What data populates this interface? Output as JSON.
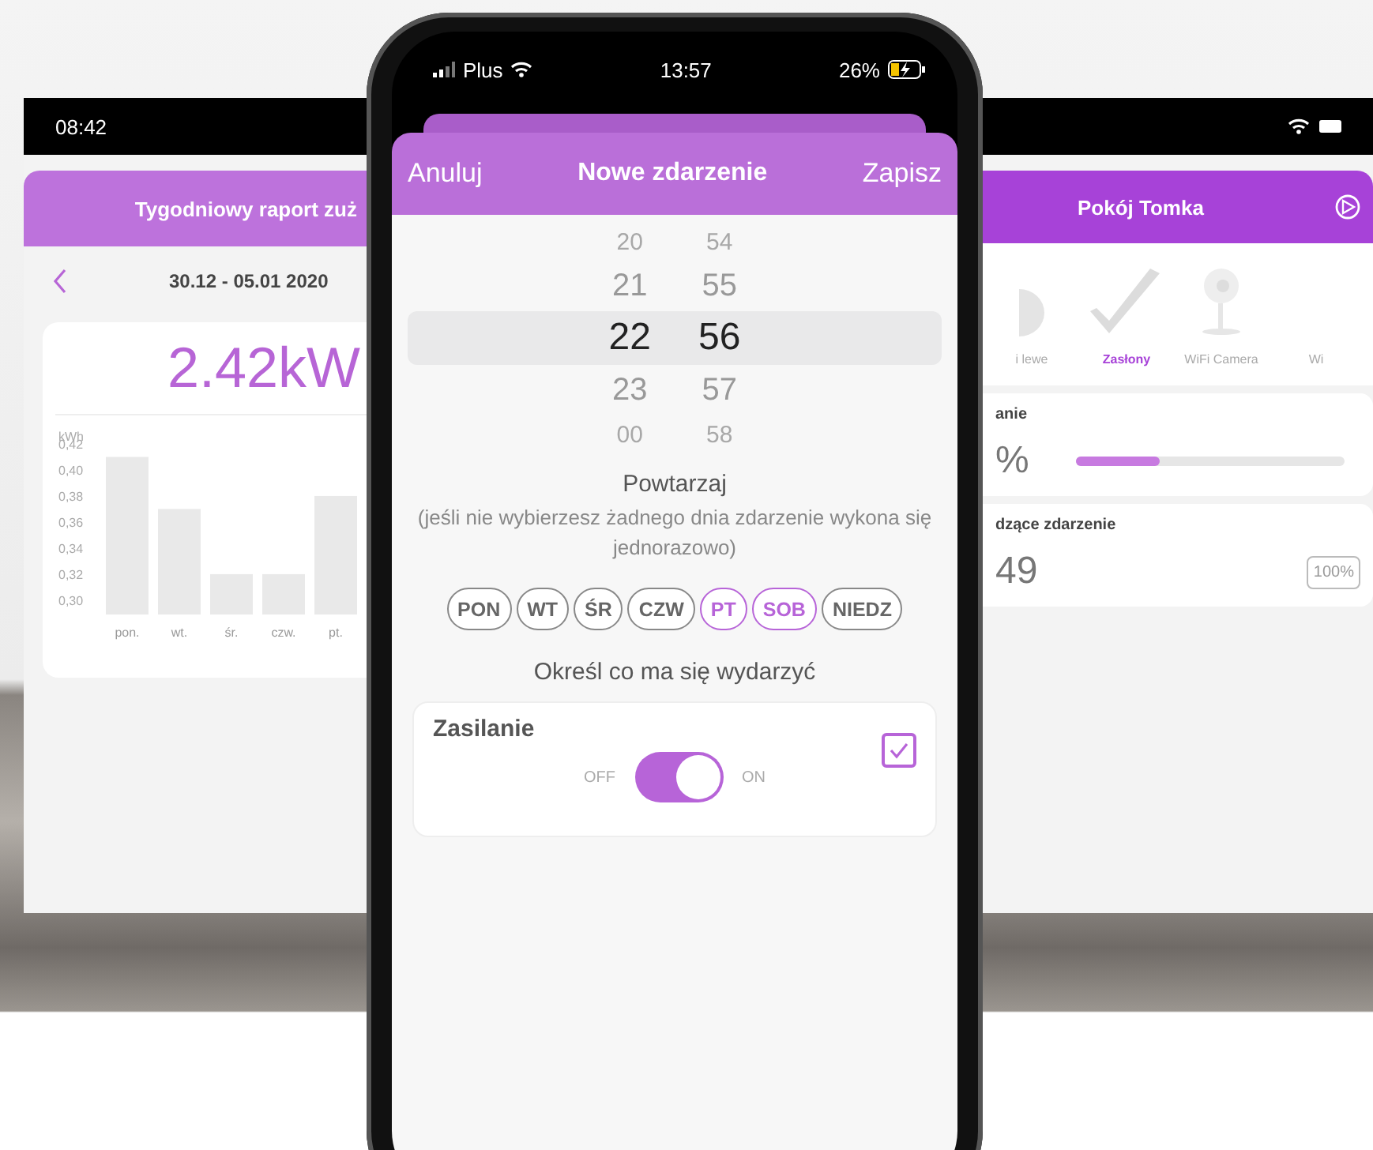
{
  "left_screen": {
    "status_time": "08:42",
    "title": "Tygodniowy raport zuż",
    "date_range": "30.12 - 05.01 2020",
    "total": "2.42kW",
    "chart_data": {
      "type": "bar",
      "ylabel": "kWh",
      "categories": [
        "pon.",
        "wt.",
        "śr.",
        "czw.",
        "pt."
      ],
      "values": [
        0.41,
        0.37,
        0.32,
        0.32,
        0.38
      ],
      "ylim": [
        0.289,
        0.42
      ],
      "yticks": [
        {
          "value": 0.3,
          "label": "0,30"
        },
        {
          "value": 0.32,
          "label": "0,32"
        },
        {
          "value": 0.34,
          "label": "0,34"
        },
        {
          "value": 0.36,
          "label": "0,36"
        },
        {
          "value": 0.38,
          "label": "0,38"
        },
        {
          "value": 0.4,
          "label": "0,40"
        },
        {
          "value": 0.42,
          "label": "0,42"
        }
      ]
    }
  },
  "phone": {
    "status": {
      "carrier": "Plus",
      "time": "13:57",
      "battery": "26%"
    },
    "header": {
      "cancel": "Anuluj",
      "title": "Nowe zdarzenie",
      "save": "Zapisz"
    },
    "picker": {
      "hours": [
        {
          "label": "20",
          "selected": false
        },
        {
          "label": "21",
          "selected": false
        },
        {
          "label": "22",
          "selected": true
        },
        {
          "label": "23",
          "selected": false
        },
        {
          "label": "00",
          "selected": false
        }
      ],
      "minutes": [
        {
          "label": "54",
          "selected": false
        },
        {
          "label": "55",
          "selected": false
        },
        {
          "label": "56",
          "selected": true
        },
        {
          "label": "57",
          "selected": false
        },
        {
          "label": "58",
          "selected": false
        }
      ]
    },
    "repeat": {
      "title": "Powtarzaj",
      "hint": "(jeśli nie wybierzesz żadnego dnia zdarzenie wykona się jednorazowo)",
      "days": [
        {
          "label": "PON",
          "selected": false
        },
        {
          "label": "WT",
          "selected": false
        },
        {
          "label": "ŚR",
          "selected": false
        },
        {
          "label": "CZW",
          "selected": false
        },
        {
          "label": "PT",
          "selected": true
        },
        {
          "label": "SOB",
          "selected": true
        },
        {
          "label": "NIEDZ",
          "selected": false
        }
      ]
    },
    "action_title": "Określ co ma się wydarzyć",
    "action": {
      "name": "Zasilanie",
      "off_label": "OFF",
      "on_label": "ON",
      "on": true,
      "checked": true
    }
  },
  "right_screen": {
    "title": "Pokój Tomka",
    "devices": [
      {
        "label": "i lewe",
        "kind": "lamp",
        "selected": false
      },
      {
        "label": "Zasłony",
        "kind": "blinds",
        "selected": true
      },
      {
        "label": "WiFi Camera",
        "kind": "camera",
        "selected": false
      },
      {
        "label": "Wi",
        "kind": "other",
        "selected": false
      }
    ],
    "level_card": {
      "title": "anie",
      "value": "%",
      "level": 0.31
    },
    "event_card": {
      "title": "dzące zdarzenie",
      "time": "49",
      "badge": "100%"
    }
  }
}
